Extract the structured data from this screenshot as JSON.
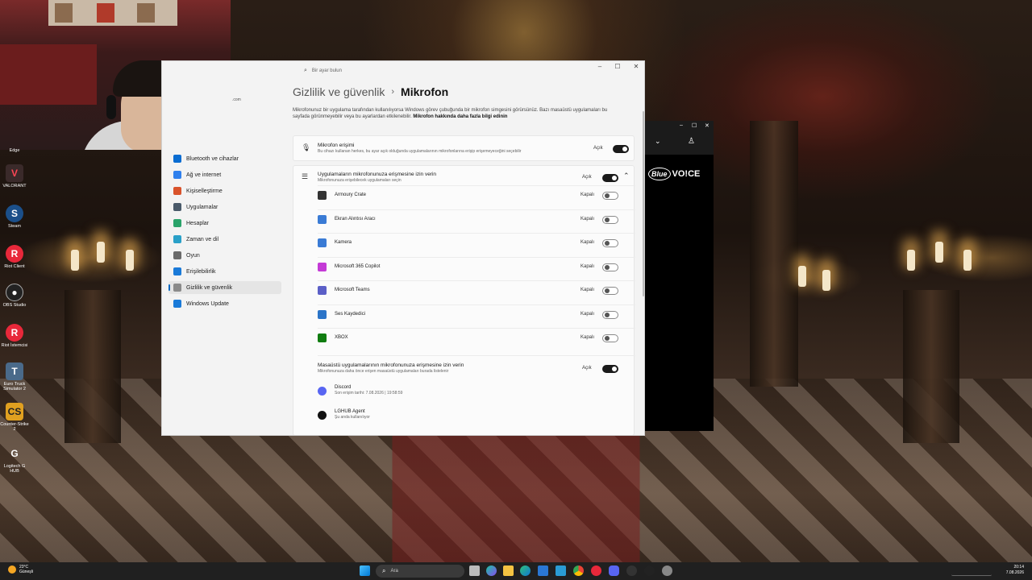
{
  "desktop": {
    "icons": [
      {
        "label": "Edge"
      },
      {
        "label": "VALORANT"
      },
      {
        "label": "Steam"
      },
      {
        "label": "Riot Client"
      },
      {
        "label": "OBS Studio"
      },
      {
        "label": "Riot İstemcisi"
      },
      {
        "label": "Euro Truck Simulator 2"
      },
      {
        "label": "Counter-Strike 2"
      },
      {
        "label": "Logitech G HUB"
      }
    ]
  },
  "settings": {
    "search_placeholder": "Bir ayar bulun",
    "account_email": ".com",
    "window_controls": {
      "minimize": "–",
      "maximize": "☐",
      "close": "✕"
    },
    "sidebar": {
      "items": [
        {
          "label": "Bluetooth ve cihazlar",
          "color": "#0a6cd1"
        },
        {
          "label": "Ağ ve internet",
          "color": "#2f80ed"
        },
        {
          "label": "Kişiselleştirme",
          "color": "#d9532b"
        },
        {
          "label": "Uygulamalar",
          "color": "#4a5a6a"
        },
        {
          "label": "Hesaplar",
          "color": "#2aa36a"
        },
        {
          "label": "Zaman ve dil",
          "color": "#2aa0c8"
        },
        {
          "label": "Oyun",
          "color": "#6a6a6a"
        },
        {
          "label": "Erişilebilirlik",
          "color": "#1a7ad8"
        },
        {
          "label": "Gizlilik ve güvenlik",
          "color": "#8a8a8a",
          "active": true
        },
        {
          "label": "Windows Update",
          "color": "#1a7ad8"
        }
      ]
    },
    "breadcrumb": {
      "parent": "Gizlilik ve güvenlik",
      "separator": "›",
      "current": "Mikrofon"
    },
    "description": {
      "text": "Mikrofonunuz bir uygulama tarafından kullanılıyorsa Windows görev çubuğunda bir mikrofon simgesini görürsünüz. Bazı masaüstü uygulamaları bu sayfada görünmeyebilir veya bu ayarlardan etkilenebilir.",
      "link": "Mikrofon hakkında daha fazla bilgi edinin"
    },
    "mic_access": {
      "title": "Mikrofon erişimi",
      "subtitle": "Bu cihazı kullanan herkes, bu ayar açık olduğunda uygulamalarının mikrofonlarına erişip erişemeyeceğini seçebilir",
      "state": "Açık",
      "on": true
    },
    "apps_access": {
      "title": "Uygulamaların mikrofonunuza erişmesine izin verin",
      "subtitle": "Mikrofonunuza erişebilecek uygulamaları seçin",
      "state": "Açık",
      "on": true
    },
    "apps": [
      {
        "name": "Armoury Crate",
        "state": "Kapalı",
        "icon_color": "#333333"
      },
      {
        "name": "Ekran Alıntısı Aracı",
        "state": "Kapalı",
        "icon_color": "#3a7bd5"
      },
      {
        "name": "Kamera",
        "state": "Kapalı",
        "icon_color": "#3a7bd5"
      },
      {
        "name": "Microsoft 365 Copilot",
        "state": "Kapalı",
        "icon_color": "#c43ad6"
      },
      {
        "name": "Microsoft Teams",
        "state": "Kapalı",
        "icon_color": "#5b5fc7"
      },
      {
        "name": "Ses Kaydedici",
        "state": "Kapalı",
        "icon_color": "#2b74c8"
      },
      {
        "name": "XBOX",
        "state": "Kapalı",
        "icon_color": "#107c10"
      }
    ],
    "desktop_apps_access": {
      "title": "Masaüstü uygulamalarının mikrofonunuza erişmesine izin verin",
      "subtitle": "Mikrofonunuza daha önce erişen masaüstü uygulamaları burada listelenir",
      "state": "Açık",
      "on": true
    },
    "desktop_apps": [
      {
        "name": "Discord",
        "detail": "Son erişim tarihi: 7.08.2026 | 19:58:59",
        "icon_color": "#5865f2"
      },
      {
        "name": "LGHUB Agent",
        "detail": "Şu anda kullanılıyor",
        "icon_color": "#111111"
      }
    ]
  },
  "blue_voice": {
    "brand": "Blue",
    "product": "VO!CE"
  },
  "taskbar": {
    "weather_temp": "23°C",
    "weather_text": "Güneşli",
    "search_placeholder": "Ara",
    "time": "20:14",
    "date": "7.08.2026"
  }
}
